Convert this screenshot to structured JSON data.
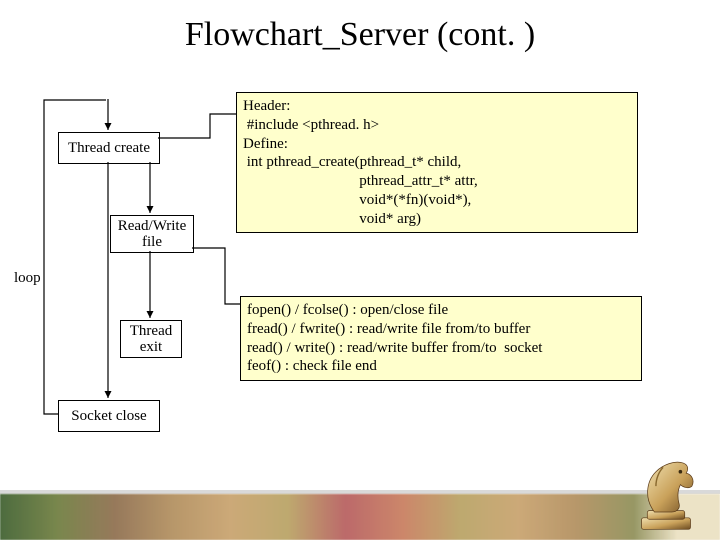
{
  "title": "Flowchart_Server (cont. )",
  "flow": {
    "thread_create": "Thread create",
    "read_write_file": "Read/Write\nfile",
    "thread_exit": "Thread\nexit",
    "socket_close": "Socket close",
    "loop_label": "loop"
  },
  "info": {
    "pthread": "Header:\n #include <pthread. h>\nDefine:\n int pthread_create(pthread_t* child,\n                               pthread_attr_t* attr,\n                               void*(*fn)(void*),\n                               void* arg)",
    "fileio": "fopen() / fcolse() : open/close file\nfread() / fwrite() : read/write file from/to buffer\nread() / write() : read/write buffer from/to  socket\nfeof() : check file end"
  }
}
